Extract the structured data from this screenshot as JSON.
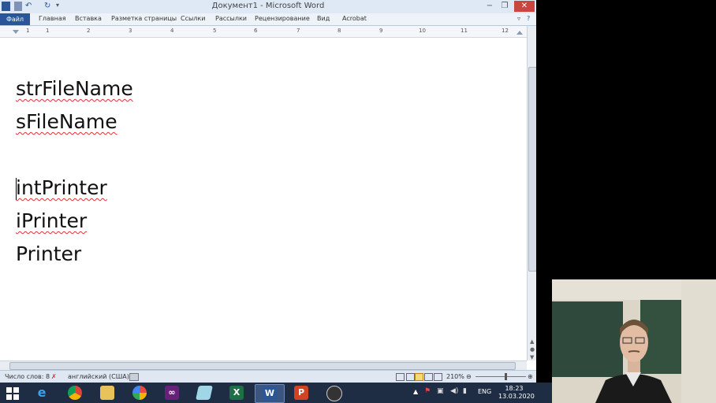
{
  "window": {
    "title": "Документ1 - Microsoft Word",
    "controls": [
      "−",
      "❐",
      "✕"
    ]
  },
  "ribbon": {
    "tabs": [
      "Файл",
      "Главная",
      "Вставка",
      "Разметка страницы",
      "Ссылки",
      "Рассылки",
      "Рецензирование",
      "Вид",
      "Acrobat"
    ]
  },
  "ruler": {
    "numbers": [
      "1",
      "1",
      "2",
      "3",
      "4",
      "5",
      "6",
      "7",
      "8",
      "9",
      "10",
      "11",
      "12"
    ]
  },
  "document": {
    "lines": [
      "strFileName",
      "sFileName",
      "",
      "intPrinter",
      "iPrinter",
      "Printer"
    ]
  },
  "status": {
    "word_count": "Число слов: 8",
    "language": "английский (США)",
    "zoom": "210%"
  },
  "taskbar": {
    "apps": [
      "start",
      "internet-explorer",
      "chrome",
      "file-explorer",
      "picasa",
      "visual-studio",
      "paper",
      "excel",
      "word",
      "powerpoint",
      "obs"
    ],
    "lang": "ENG",
    "time": "18:23",
    "date": "13.03.2020"
  },
  "colors": {
    "file_tab": "#2a5699",
    "spell_error": "#e03030",
    "taskbar": "#1f2d44"
  }
}
